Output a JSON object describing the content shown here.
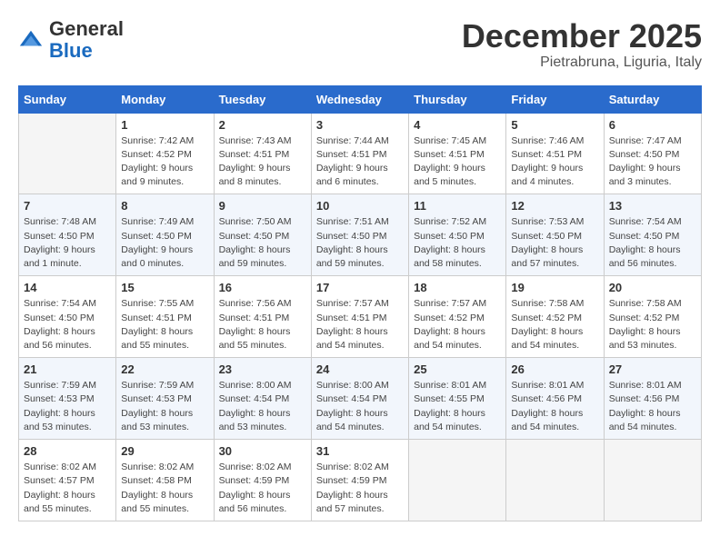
{
  "header": {
    "logo_general": "General",
    "logo_blue": "Blue",
    "month": "December 2025",
    "location": "Pietrabruna, Liguria, Italy"
  },
  "days_of_week": [
    "Sunday",
    "Monday",
    "Tuesday",
    "Wednesday",
    "Thursday",
    "Friday",
    "Saturday"
  ],
  "weeks": [
    [
      {
        "day": "",
        "empty": true
      },
      {
        "day": "1",
        "sunrise": "Sunrise: 7:42 AM",
        "sunset": "Sunset: 4:52 PM",
        "daylight": "Daylight: 9 hours and 9 minutes."
      },
      {
        "day": "2",
        "sunrise": "Sunrise: 7:43 AM",
        "sunset": "Sunset: 4:51 PM",
        "daylight": "Daylight: 9 hours and 8 minutes."
      },
      {
        "day": "3",
        "sunrise": "Sunrise: 7:44 AM",
        "sunset": "Sunset: 4:51 PM",
        "daylight": "Daylight: 9 hours and 6 minutes."
      },
      {
        "day": "4",
        "sunrise": "Sunrise: 7:45 AM",
        "sunset": "Sunset: 4:51 PM",
        "daylight": "Daylight: 9 hours and 5 minutes."
      },
      {
        "day": "5",
        "sunrise": "Sunrise: 7:46 AM",
        "sunset": "Sunset: 4:51 PM",
        "daylight": "Daylight: 9 hours and 4 minutes."
      },
      {
        "day": "6",
        "sunrise": "Sunrise: 7:47 AM",
        "sunset": "Sunset: 4:50 PM",
        "daylight": "Daylight: 9 hours and 3 minutes."
      }
    ],
    [
      {
        "day": "7",
        "sunrise": "Sunrise: 7:48 AM",
        "sunset": "Sunset: 4:50 PM",
        "daylight": "Daylight: 9 hours and 1 minute."
      },
      {
        "day": "8",
        "sunrise": "Sunrise: 7:49 AM",
        "sunset": "Sunset: 4:50 PM",
        "daylight": "Daylight: 9 hours and 0 minutes."
      },
      {
        "day": "9",
        "sunrise": "Sunrise: 7:50 AM",
        "sunset": "Sunset: 4:50 PM",
        "daylight": "Daylight: 8 hours and 59 minutes."
      },
      {
        "day": "10",
        "sunrise": "Sunrise: 7:51 AM",
        "sunset": "Sunset: 4:50 PM",
        "daylight": "Daylight: 8 hours and 59 minutes."
      },
      {
        "day": "11",
        "sunrise": "Sunrise: 7:52 AM",
        "sunset": "Sunset: 4:50 PM",
        "daylight": "Daylight: 8 hours and 58 minutes."
      },
      {
        "day": "12",
        "sunrise": "Sunrise: 7:53 AM",
        "sunset": "Sunset: 4:50 PM",
        "daylight": "Daylight: 8 hours and 57 minutes."
      },
      {
        "day": "13",
        "sunrise": "Sunrise: 7:54 AM",
        "sunset": "Sunset: 4:50 PM",
        "daylight": "Daylight: 8 hours and 56 minutes."
      }
    ],
    [
      {
        "day": "14",
        "sunrise": "Sunrise: 7:54 AM",
        "sunset": "Sunset: 4:50 PM",
        "daylight": "Daylight: 8 hours and 56 minutes."
      },
      {
        "day": "15",
        "sunrise": "Sunrise: 7:55 AM",
        "sunset": "Sunset: 4:51 PM",
        "daylight": "Daylight: 8 hours and 55 minutes."
      },
      {
        "day": "16",
        "sunrise": "Sunrise: 7:56 AM",
        "sunset": "Sunset: 4:51 PM",
        "daylight": "Daylight: 8 hours and 55 minutes."
      },
      {
        "day": "17",
        "sunrise": "Sunrise: 7:57 AM",
        "sunset": "Sunset: 4:51 PM",
        "daylight": "Daylight: 8 hours and 54 minutes."
      },
      {
        "day": "18",
        "sunrise": "Sunrise: 7:57 AM",
        "sunset": "Sunset: 4:52 PM",
        "daylight": "Daylight: 8 hours and 54 minutes."
      },
      {
        "day": "19",
        "sunrise": "Sunrise: 7:58 AM",
        "sunset": "Sunset: 4:52 PM",
        "daylight": "Daylight: 8 hours and 54 minutes."
      },
      {
        "day": "20",
        "sunrise": "Sunrise: 7:58 AM",
        "sunset": "Sunset: 4:52 PM",
        "daylight": "Daylight: 8 hours and 53 minutes."
      }
    ],
    [
      {
        "day": "21",
        "sunrise": "Sunrise: 7:59 AM",
        "sunset": "Sunset: 4:53 PM",
        "daylight": "Daylight: 8 hours and 53 minutes."
      },
      {
        "day": "22",
        "sunrise": "Sunrise: 7:59 AM",
        "sunset": "Sunset: 4:53 PM",
        "daylight": "Daylight: 8 hours and 53 minutes."
      },
      {
        "day": "23",
        "sunrise": "Sunrise: 8:00 AM",
        "sunset": "Sunset: 4:54 PM",
        "daylight": "Daylight: 8 hours and 53 minutes."
      },
      {
        "day": "24",
        "sunrise": "Sunrise: 8:00 AM",
        "sunset": "Sunset: 4:54 PM",
        "daylight": "Daylight: 8 hours and 54 minutes."
      },
      {
        "day": "25",
        "sunrise": "Sunrise: 8:01 AM",
        "sunset": "Sunset: 4:55 PM",
        "daylight": "Daylight: 8 hours and 54 minutes."
      },
      {
        "day": "26",
        "sunrise": "Sunrise: 8:01 AM",
        "sunset": "Sunset: 4:56 PM",
        "daylight": "Daylight: 8 hours and 54 minutes."
      },
      {
        "day": "27",
        "sunrise": "Sunrise: 8:01 AM",
        "sunset": "Sunset: 4:56 PM",
        "daylight": "Daylight: 8 hours and 54 minutes."
      }
    ],
    [
      {
        "day": "28",
        "sunrise": "Sunrise: 8:02 AM",
        "sunset": "Sunset: 4:57 PM",
        "daylight": "Daylight: 8 hours and 55 minutes."
      },
      {
        "day": "29",
        "sunrise": "Sunrise: 8:02 AM",
        "sunset": "Sunset: 4:58 PM",
        "daylight": "Daylight: 8 hours and 55 minutes."
      },
      {
        "day": "30",
        "sunrise": "Sunrise: 8:02 AM",
        "sunset": "Sunset: 4:59 PM",
        "daylight": "Daylight: 8 hours and 56 minutes."
      },
      {
        "day": "31",
        "sunrise": "Sunrise: 8:02 AM",
        "sunset": "Sunset: 4:59 PM",
        "daylight": "Daylight: 8 hours and 57 minutes."
      },
      {
        "day": "",
        "empty": true
      },
      {
        "day": "",
        "empty": true
      },
      {
        "day": "",
        "empty": true
      }
    ]
  ]
}
